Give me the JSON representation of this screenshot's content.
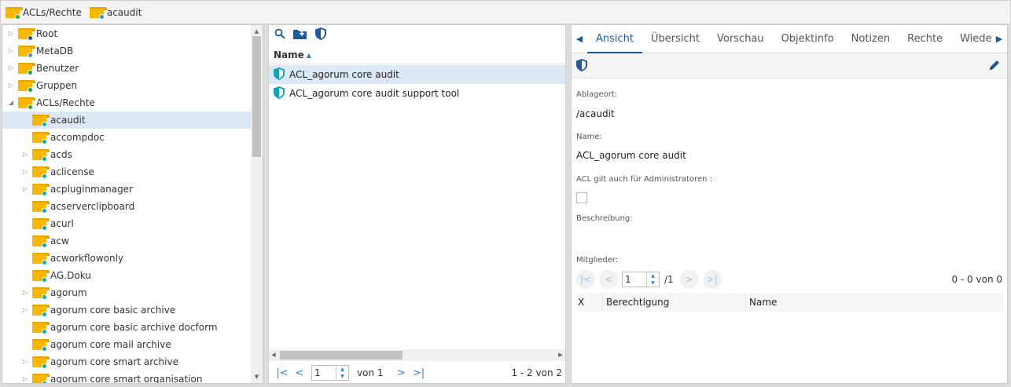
{
  "breadcrumb": [
    {
      "label": "ACLs/Rechte",
      "badge_color": "#2aa84a"
    },
    {
      "label": "acaudit",
      "badge_color": "#19a7a7"
    }
  ],
  "tree": {
    "items": [
      {
        "label": "Root",
        "level": 0,
        "expand": "collapsed",
        "badge_color": "#1e5aa0"
      },
      {
        "label": "MetaDB",
        "level": 0,
        "expand": "collapsed",
        "badge_color": "#5b8bd0"
      },
      {
        "label": "Benutzer",
        "level": 0,
        "expand": "collapsed",
        "badge_color": "#1e9a7a"
      },
      {
        "label": "Gruppen",
        "level": 0,
        "expand": "collapsed",
        "badge_color": "#1e9a7a"
      },
      {
        "label": "ACLs/Rechte",
        "level": 0,
        "expand": "expanded",
        "badge_color": "#2aa84a"
      },
      {
        "label": "acaudit",
        "level": 1,
        "expand": "none",
        "badge_color": "#19a7a7",
        "selected": true
      },
      {
        "label": "accompdoc",
        "level": 1,
        "expand": "none",
        "badge_color": "#19a7a7"
      },
      {
        "label": "acds",
        "level": 1,
        "expand": "collapsed",
        "badge_color": "#19a7a7"
      },
      {
        "label": "aclicense",
        "level": 1,
        "expand": "collapsed",
        "badge_color": "#19a7a7"
      },
      {
        "label": "acpluginmanager",
        "level": 1,
        "expand": "collapsed",
        "badge_color": "#19a7a7"
      },
      {
        "label": "acserverclipboard",
        "level": 1,
        "expand": "none",
        "badge_color": "#19a7a7"
      },
      {
        "label": "acurl",
        "level": 1,
        "expand": "none",
        "badge_color": "#19a7a7"
      },
      {
        "label": "acw",
        "level": 1,
        "expand": "none",
        "badge_color": "#19a7a7"
      },
      {
        "label": "acworkflowonly",
        "level": 1,
        "expand": "none",
        "badge_color": "#19a7a7"
      },
      {
        "label": "AG.Doku",
        "level": 1,
        "expand": "none",
        "badge_color": "#19a7a7"
      },
      {
        "label": "agorum",
        "level": 1,
        "expand": "collapsed",
        "badge_color": "#19a7a7"
      },
      {
        "label": "agorum core basic archive",
        "level": 1,
        "expand": "collapsed",
        "badge_color": "#19a7a7"
      },
      {
        "label": "agorum core basic archive docform",
        "level": 1,
        "expand": "none",
        "badge_color": "#19a7a7"
      },
      {
        "label": "agorum core mail archive",
        "level": 1,
        "expand": "none",
        "badge_color": "#19a7a7"
      },
      {
        "label": "agorum core smart archive",
        "level": 1,
        "expand": "collapsed",
        "badge_color": "#19a7a7"
      },
      {
        "label": "agorum core smart organisation",
        "level": 1,
        "expand": "collapsed",
        "badge_color": "#19a7a7"
      }
    ]
  },
  "list": {
    "toolbar": [
      "search-icon",
      "new-folder-icon",
      "shield-icon"
    ],
    "column_header": "Name",
    "rows": [
      {
        "label": "ACL_agorum core audit",
        "selected": true
      },
      {
        "label": "ACL_agorum core audit support tool",
        "selected": false
      }
    ],
    "pager": {
      "page": "1",
      "of_label": "von 1",
      "summary": "1 - 2 von 2"
    }
  },
  "detail": {
    "tabs": [
      "Ansicht",
      "Übersicht",
      "Vorschau",
      "Objektinfo",
      "Notizen",
      "Rechte",
      "Wiede"
    ],
    "active_tab": "Ansicht",
    "ablageort_label": "Ablageort:",
    "ablageort_value": "/acaudit",
    "name_label": "Name:",
    "name_value": "ACL_agorum core audit",
    "admin_label": "ACL gilt auch für Administratoren :",
    "admin_checked": false,
    "beschreibung_label": "Beschreibung:",
    "mitglieder_label": "Mitglieder:",
    "members_pager": {
      "page": "1",
      "total": "/1",
      "summary": "0 - 0 von 0"
    },
    "members_columns": [
      "X",
      "Berechtigung",
      "Name"
    ]
  },
  "colors": {
    "accent": "#1e5aa0",
    "link": "#2a7fd4",
    "selection": "#dde8f6",
    "folder": "#f8b700",
    "shield": "#17a2b8"
  }
}
